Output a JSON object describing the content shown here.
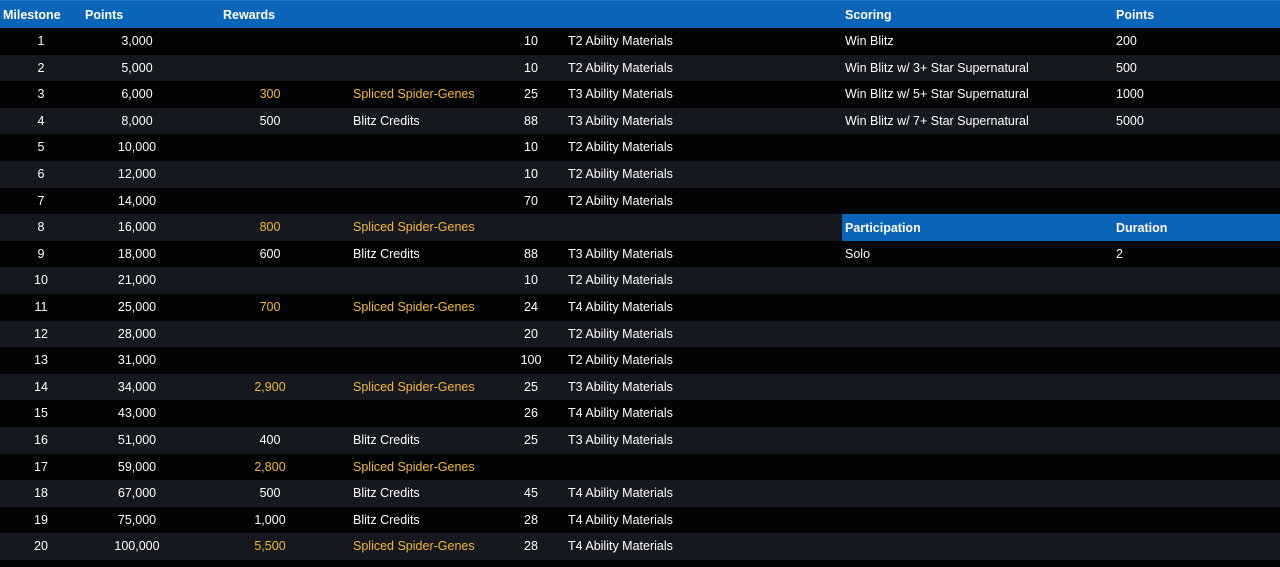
{
  "header": {
    "milestone": "Milestone",
    "points": "Points",
    "rewards": "Rewards",
    "scoring": "Scoring",
    "scoring_points": "Points"
  },
  "milestones": [
    {
      "milestone": "1",
      "points": "3,000",
      "reward_qty": "",
      "reward_name": "",
      "material_qty": "10",
      "material_name": "T2 Ability Materials"
    },
    {
      "milestone": "2",
      "points": "5,000",
      "reward_qty": "",
      "reward_name": "",
      "material_qty": "10",
      "material_name": "T2 Ability Materials"
    },
    {
      "milestone": "3",
      "points": "6,000",
      "reward_qty": "300",
      "reward_name": "Spliced Spider-Genes",
      "material_qty": "25",
      "material_name": "T3 Ability Materials"
    },
    {
      "milestone": "4",
      "points": "8,000",
      "reward_qty": "500",
      "reward_name": "Blitz Credits",
      "material_qty": "88",
      "material_name": "T3 Ability Materials"
    },
    {
      "milestone": "5",
      "points": "10,000",
      "reward_qty": "",
      "reward_name": "",
      "material_qty": "10",
      "material_name": "T2 Ability Materials"
    },
    {
      "milestone": "6",
      "points": "12,000",
      "reward_qty": "",
      "reward_name": "",
      "material_qty": "10",
      "material_name": "T2 Ability Materials"
    },
    {
      "milestone": "7",
      "points": "14,000",
      "reward_qty": "",
      "reward_name": "",
      "material_qty": "70",
      "material_name": "T2 Ability Materials"
    },
    {
      "milestone": "8",
      "points": "16,000",
      "reward_qty": "800",
      "reward_name": "Spliced Spider-Genes",
      "material_qty": "",
      "material_name": ""
    },
    {
      "milestone": "9",
      "points": "18,000",
      "reward_qty": "600",
      "reward_name": "Blitz Credits",
      "material_qty": "88",
      "material_name": "T3 Ability Materials"
    },
    {
      "milestone": "10",
      "points": "21,000",
      "reward_qty": "",
      "reward_name": "",
      "material_qty": "10",
      "material_name": "T2 Ability Materials"
    },
    {
      "milestone": "11",
      "points": "25,000",
      "reward_qty": "700",
      "reward_name": "Spliced Spider-Genes",
      "material_qty": "24",
      "material_name": "T4 Ability Materials"
    },
    {
      "milestone": "12",
      "points": "28,000",
      "reward_qty": "",
      "reward_name": "",
      "material_qty": "20",
      "material_name": "T2 Ability Materials"
    },
    {
      "milestone": "13",
      "points": "31,000",
      "reward_qty": "",
      "reward_name": "",
      "material_qty": "100",
      "material_name": "T2 Ability Materials"
    },
    {
      "milestone": "14",
      "points": "34,000",
      "reward_qty": "2,900",
      "reward_name": "Spliced Spider-Genes",
      "material_qty": "25",
      "material_name": "T3 Ability Materials"
    },
    {
      "milestone": "15",
      "points": "43,000",
      "reward_qty": "",
      "reward_name": "",
      "material_qty": "26",
      "material_name": "T4 Ability Materials"
    },
    {
      "milestone": "16",
      "points": "51,000",
      "reward_qty": "400",
      "reward_name": "Blitz Credits",
      "material_qty": "25",
      "material_name": "T3 Ability Materials"
    },
    {
      "milestone": "17",
      "points": "59,000",
      "reward_qty": "2,800",
      "reward_name": "Spliced Spider-Genes",
      "material_qty": "",
      "material_name": ""
    },
    {
      "milestone": "18",
      "points": "67,000",
      "reward_qty": "500",
      "reward_name": "Blitz Credits",
      "material_qty": "45",
      "material_name": "T4 Ability Materials"
    },
    {
      "milestone": "19",
      "points": "75,000",
      "reward_qty": "1,000",
      "reward_name": "Blitz Credits",
      "material_qty": "28",
      "material_name": "T4 Ability Materials"
    },
    {
      "milestone": "20",
      "points": "100,000",
      "reward_qty": "5,500",
      "reward_name": "Spliced Spider-Genes",
      "material_qty": "28",
      "material_name": "T4 Ability Materials"
    }
  ],
  "scoring": [
    {
      "label": "Win Blitz",
      "points": "200"
    },
    {
      "label": "Win Blitz w/ 3+ Star Supernatural",
      "points": "500"
    },
    {
      "label": "Win Blitz w/ 5+ Star Supernatural",
      "points": "1000"
    },
    {
      "label": "Win Blitz w/ 7+ Star Supernatural",
      "points": "5000"
    }
  ],
  "participation_header": {
    "participation": "Participation",
    "duration": "Duration"
  },
  "participation": {
    "type": "Solo",
    "duration": "2"
  },
  "colors": {
    "header_bg": "#0a64b8",
    "row_dark": "#020304",
    "row_light": "#15191f",
    "highlight": "#f5b92d",
    "text": "#ffffff"
  }
}
